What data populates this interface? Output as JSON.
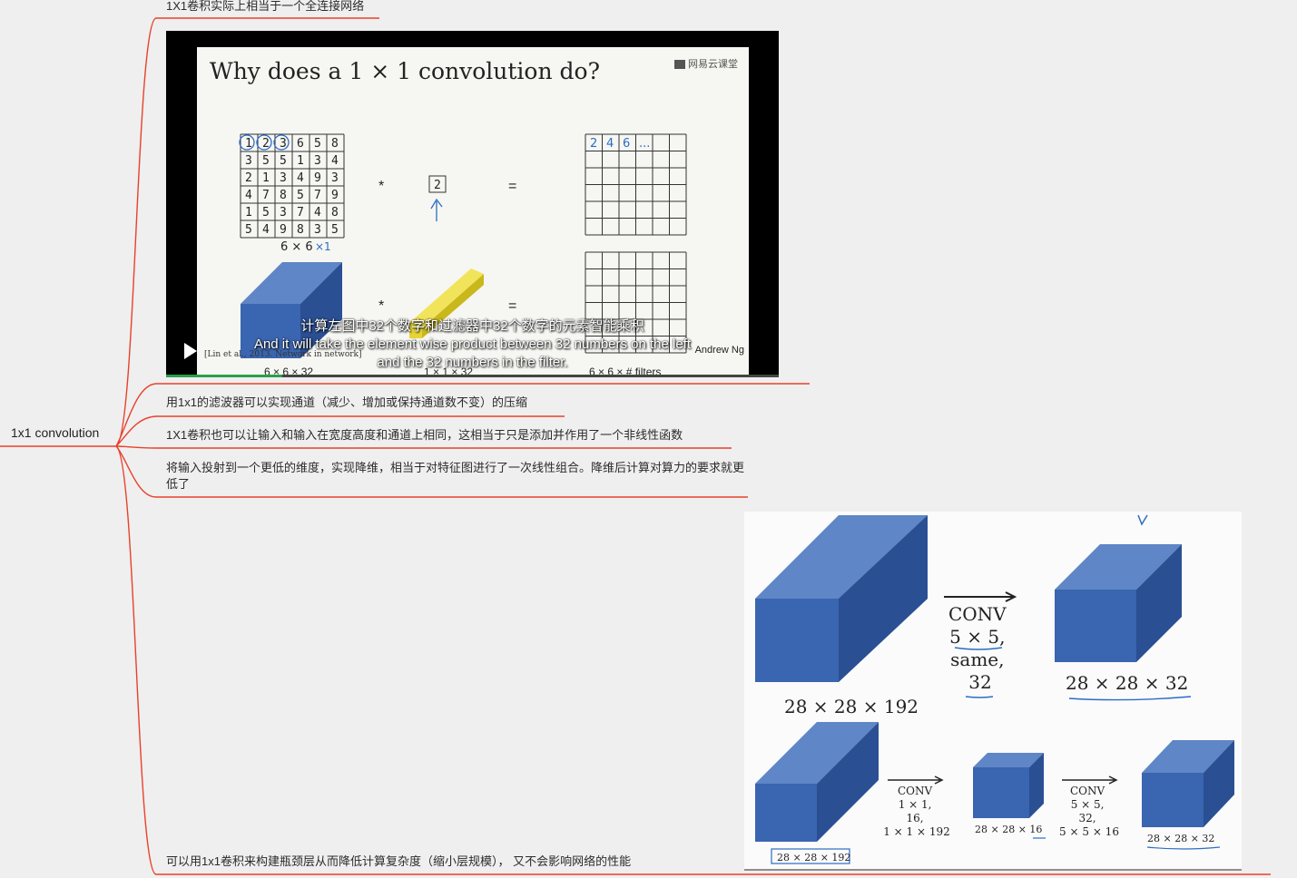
{
  "root": {
    "label": "1x1 convolution"
  },
  "branches": [
    {
      "text": "1X1卷积实际上相当于一个全连接网络"
    },
    {
      "text": "用1x1的滤波器可以实现通道（减少、增加或保持通道数不变）的压缩"
    },
    {
      "text": "1X1卷积也可以让输入和输入在宽度高度和通道上相同，这相当于只是添加并作用了一个非线性函数"
    },
    {
      "text": "将输入投射到一个更低的维度，实现降维，相当于对特征图进行了一次线性组合。降维后计算对算力的要求就更低了"
    },
    {
      "text": "可以用1x1卷积来构建瓶颈层从而降低计算复杂度（缩小层规模）， 又不会影响网络的性能"
    }
  ],
  "video": {
    "slide_title": "Why does a 1 × 1 convolution do?",
    "logo": "网易云课堂",
    "matrix": [
      [
        "1",
        "2",
        "3",
        "6",
        "5",
        "8"
      ],
      [
        "3",
        "5",
        "5",
        "1",
        "3",
        "4"
      ],
      [
        "2",
        "1",
        "3",
        "4",
        "9",
        "3"
      ],
      [
        "4",
        "7",
        "8",
        "5",
        "7",
        "9"
      ],
      [
        "1",
        "5",
        "3",
        "7",
        "4",
        "8"
      ],
      [
        "5",
        "4",
        "9",
        "8",
        "3",
        "5"
      ]
    ],
    "matrix_label": "6 × 6",
    "matrix_label_note": "×1",
    "filter_value": "2",
    "op_star": "*",
    "op_equals": "=",
    "output_values": [
      "2",
      "4",
      "6",
      "..."
    ],
    "volume_label": "6 × 6 × 32",
    "filter_volume_label": "1 × 1 × 32",
    "output_volume_label": "6 × 6 × # filters",
    "subtitle_cn": "计算左图中32个数字和过滤器中32个数字的元素智能乘积",
    "subtitle_en_1": "And it will take the element wise product between 32 numbers on the left",
    "subtitle_en_2": "and the 32 numbers in the filter.",
    "citation": "[Lin et al., 2013. Network in network]",
    "credit": "Andrew Ng",
    "progress": 0.19
  },
  "figure2": {
    "input_label": "28 × 28 × 192",
    "conv_lines": [
      "CONV",
      "5 × 5,",
      "same,",
      "32"
    ],
    "output_label": "28 × 28 × 32",
    "bottom_input_label": "28 × 28 × 192",
    "conv1_lines": [
      "CONV",
      "1 × 1,",
      "16,",
      "1 × 1 × 192"
    ],
    "mid_label": "28 × 28 × 16",
    "conv2_lines": [
      "CONV",
      "5 × 5,",
      "32,",
      "5 × 5 × 16"
    ],
    "bottom_output_label": "28 × 28 × 32"
  },
  "colors": {
    "branch": "#e8412c",
    "cube_front": "#3a65b0",
    "cube_top": "#5f86c6",
    "cube_side": "#2a4f93",
    "filter_yellow": "#e5d534",
    "ink_blue": "#2b6cc4"
  }
}
